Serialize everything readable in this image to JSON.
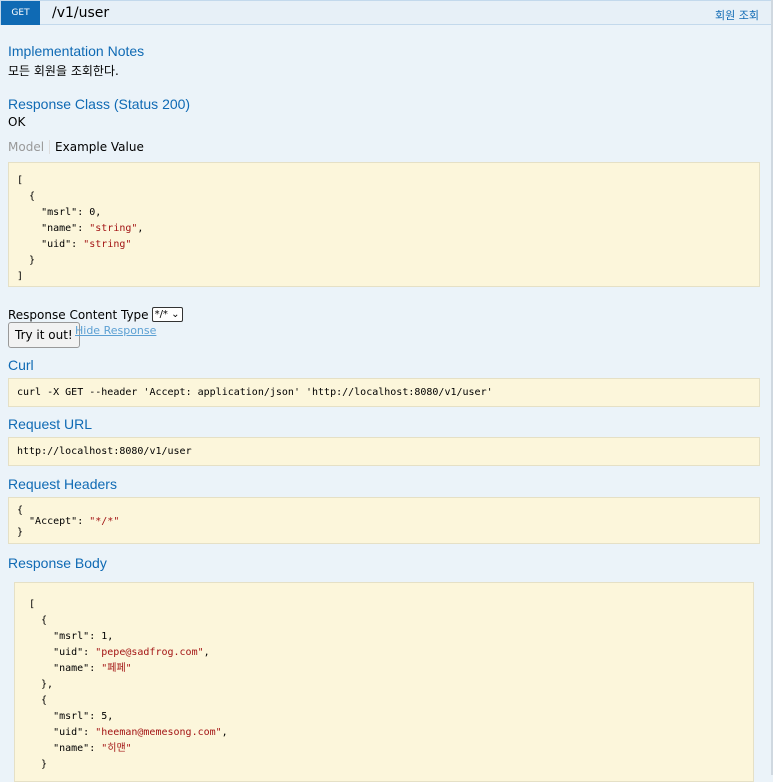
{
  "heading": {
    "method": "GET",
    "path": "/v1/user",
    "summary": "회원 조회"
  },
  "implementation_notes": {
    "title": "Implementation Notes",
    "text": "모든 회원을 조회한다."
  },
  "response_class": {
    "title": "Response Class (Status 200)",
    "status": "OK",
    "tabs": [
      "Model",
      "Example Value"
    ],
    "example_lines": [
      "[",
      "  {",
      "    \"msrl\": 0,",
      "    \"name\": \"string\",",
      "    \"uid\": \"string\"",
      "  }",
      "]"
    ]
  },
  "response_content_type": {
    "label": "Response Content Type",
    "selected": "*/*"
  },
  "actions": {
    "try_label": "Try it out!",
    "hide_label": "Hide Response"
  },
  "curl": {
    "title": "Curl",
    "value": "curl -X GET --header 'Accept: application/json' 'http://localhost:8080/v1/user'"
  },
  "request_url": {
    "title": "Request URL",
    "value": "http://localhost:8080/v1/user"
  },
  "request_headers": {
    "title": "Request Headers",
    "lines": [
      "{",
      "  \"Accept\": \"*/*\"",
      "}"
    ]
  },
  "response_body": {
    "title": "Response Body",
    "lines": [
      "[",
      "  {",
      "    \"msrl\": 1,",
      "    \"uid\": \"pepe@sadfrog.com\",",
      "    \"name\": \"페페\"",
      "  },",
      "  {",
      "    \"msrl\": 5,",
      "    \"uid\": \"heeman@memesong.com\",",
      "    \"name\": \"히맨\"",
      "  }"
    ]
  },
  "colors": {
    "method_bg": "#0f6ab4",
    "title_blue": "#0f6ab4",
    "box_bg": "#fcf6db",
    "page_bg": "#ebf3f9"
  }
}
